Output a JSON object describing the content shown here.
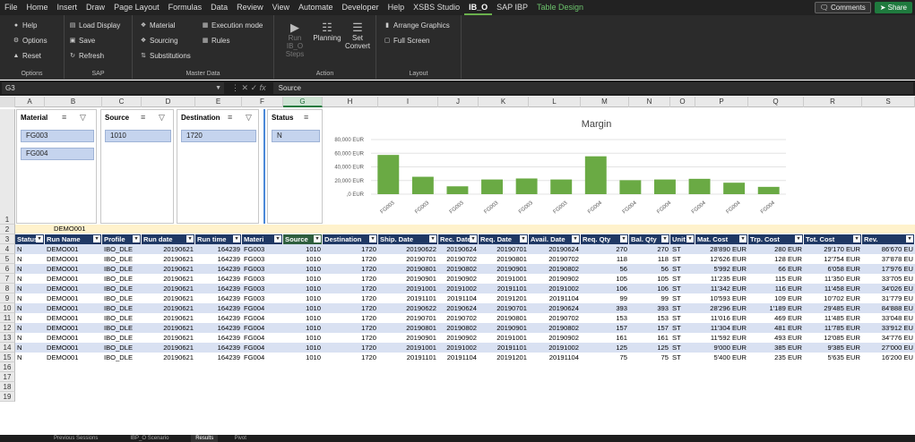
{
  "menu": {
    "tabs": [
      "File",
      "Home",
      "Insert",
      "Draw",
      "Page Layout",
      "Formulas",
      "Data",
      "Review",
      "View",
      "Automate",
      "Developer",
      "Help",
      "XSBS Studio",
      "IB_O",
      "SAP IBP",
      "Table Design"
    ],
    "active_tab": "IB_O",
    "comments_label": "Comments",
    "share_label": "Share"
  },
  "ribbon": {
    "options_group": {
      "label": "Options",
      "items": [
        "Help",
        "Options",
        "Reset"
      ]
    },
    "sap_group": {
      "label": "SAP",
      "items": [
        "Load Display",
        "Save",
        "Refresh"
      ]
    },
    "master_group": {
      "label": "Master Data",
      "items": [
        "Material",
        "Sourcing",
        "Substitutions",
        "Execution mode",
        "Rules"
      ]
    },
    "action_group": {
      "label": "Action",
      "run_label": "Run IB_O Steps",
      "planning_label": "Planning",
      "set_convert_label": "Set Convert"
    },
    "layout_group": {
      "label": "Layout",
      "items": [
        "Arrange Graphics",
        "Full Screen"
      ]
    }
  },
  "formula_bar": {
    "name_box": "G3",
    "formula": "Source"
  },
  "columns": [
    "A",
    "B",
    "C",
    "D",
    "E",
    "F",
    "G",
    "H",
    "I",
    "J",
    "K",
    "L",
    "M",
    "N",
    "O",
    "P",
    "Q",
    "R",
    "S"
  ],
  "selected_column": "G",
  "slicers": [
    {
      "title": "Material",
      "items": [
        "FG003",
        "FG004"
      ]
    },
    {
      "title": "Source",
      "items": [
        "1010"
      ]
    },
    {
      "title": "Destination",
      "items": [
        "1720"
      ]
    },
    {
      "title": "Status",
      "items": [
        "N"
      ]
    }
  ],
  "chart_data": {
    "type": "bar",
    "title": "Margin",
    "categories": [
      "FG003",
      "FG003",
      "FG003",
      "FG003",
      "FG003",
      "FG003",
      "FG004",
      "FG004",
      "FG004",
      "FG004",
      "FG004",
      "FG004"
    ],
    "values": [
      57500,
      25500,
      11500,
      21500,
      23000,
      21500,
      55500,
      20500,
      21500,
      22500,
      16800,
      10700
    ],
    "ylim": [
      0,
      80000
    ],
    "yticks": [
      "80,000 EUR",
      "60,000 EUR",
      "40,000 EUR",
      "20,000 EUR",
      ",0 EUR"
    ],
    "color": "#6aaa44"
  },
  "row2_label": "DEMO001",
  "table": {
    "headers": [
      "Status",
      "Run Name",
      "Profile",
      "Run date",
      "Run time",
      "Materi",
      "Source",
      "Destination",
      "Ship. Date",
      "Rec. Date",
      "Req. Date",
      "Avail. Date",
      "Req. Qty",
      "Bal. Qty",
      "Unit",
      "Mat. Cost",
      "Trp. Cost",
      "Tot. Cost",
      "Rev."
    ],
    "rows": [
      [
        "N",
        "DEMO001",
        "IBO_DLE",
        "20190621",
        "164239",
        "FG003",
        "1010",
        "1720",
        "20190622",
        "20190624",
        "20190701",
        "20190624",
        "270",
        "270",
        "ST",
        "28'890 EUR",
        "280 EUR",
        "29'170 EUR",
        "86'670 EU"
      ],
      [
        "N",
        "DEMO001",
        "IBO_DLE",
        "20190621",
        "164239",
        "FG003",
        "1010",
        "1720",
        "20190701",
        "20190702",
        "20190801",
        "20190702",
        "118",
        "118",
        "ST",
        "12'626 EUR",
        "128 EUR",
        "12'754 EUR",
        "37'878 EU"
      ],
      [
        "N",
        "DEMO001",
        "IBO_DLE",
        "20190621",
        "164239",
        "FG003",
        "1010",
        "1720",
        "20190801",
        "20190802",
        "20190901",
        "20190802",
        "56",
        "56",
        "ST",
        "5'992 EUR",
        "66 EUR",
        "6'058 EUR",
        "17'976 EU"
      ],
      [
        "N",
        "DEMO001",
        "IBO_DLE",
        "20190621",
        "164239",
        "FG003",
        "1010",
        "1720",
        "20190901",
        "20190902",
        "20191001",
        "20190902",
        "105",
        "105",
        "ST",
        "11'235 EUR",
        "115 EUR",
        "11'350 EUR",
        "33'705 EU"
      ],
      [
        "N",
        "DEMO001",
        "IBO_DLE",
        "20190621",
        "164239",
        "FG003",
        "1010",
        "1720",
        "20191001",
        "20191002",
        "20191101",
        "20191002",
        "106",
        "106",
        "ST",
        "11'342 EUR",
        "116 EUR",
        "11'458 EUR",
        "34'026 EU"
      ],
      [
        "N",
        "DEMO001",
        "IBO_DLE",
        "20190621",
        "164239",
        "FG003",
        "1010",
        "1720",
        "20191101",
        "20191104",
        "20191201",
        "20191104",
        "99",
        "99",
        "ST",
        "10'593 EUR",
        "109 EUR",
        "10'702 EUR",
        "31'779 EU"
      ],
      [
        "N",
        "DEMO001",
        "IBO_DLE",
        "20190621",
        "164239",
        "FG004",
        "1010",
        "1720",
        "20190622",
        "20190624",
        "20190701",
        "20190624",
        "393",
        "393",
        "ST",
        "28'296 EUR",
        "1'189 EUR",
        "29'485 EUR",
        "84'888 EU"
      ],
      [
        "N",
        "DEMO001",
        "IBO_DLE",
        "20190621",
        "164239",
        "FG004",
        "1010",
        "1720",
        "20190701",
        "20190702",
        "20190801",
        "20190702",
        "153",
        "153",
        "ST",
        "11'016 EUR",
        "469 EUR",
        "11'485 EUR",
        "33'048 EU"
      ],
      [
        "N",
        "DEMO001",
        "IBO_DLE",
        "20190621",
        "164239",
        "FG004",
        "1010",
        "1720",
        "20190801",
        "20190802",
        "20190901",
        "20190802",
        "157",
        "157",
        "ST",
        "11'304 EUR",
        "481 EUR",
        "11'785 EUR",
        "33'912 EU"
      ],
      [
        "N",
        "DEMO001",
        "IBO_DLE",
        "20190621",
        "164239",
        "FG004",
        "1010",
        "1720",
        "20190901",
        "20190902",
        "20191001",
        "20190902",
        "161",
        "161",
        "ST",
        "11'592 EUR",
        "493 EUR",
        "12'085 EUR",
        "34'776 EU"
      ],
      [
        "N",
        "DEMO001",
        "IBO_DLE",
        "20190621",
        "164239",
        "FG004",
        "1010",
        "1720",
        "20191001",
        "20191002",
        "20191101",
        "20191002",
        "125",
        "125",
        "ST",
        "9'000 EUR",
        "385 EUR",
        "9'385 EUR",
        "27'000 EU"
      ],
      [
        "N",
        "DEMO001",
        "IBO_DLE",
        "20190621",
        "164239",
        "FG004",
        "1010",
        "1720",
        "20191101",
        "20191104",
        "20191201",
        "20191104",
        "75",
        "75",
        "ST",
        "5'400 EUR",
        "235 EUR",
        "5'635 EUR",
        "16'200 EU"
      ]
    ]
  },
  "row_numbers": [
    "1",
    "2",
    "3",
    "4",
    "5",
    "6",
    "7",
    "8",
    "9",
    "10",
    "11",
    "12",
    "13",
    "14",
    "15",
    "16",
    "17",
    "18",
    "19"
  ],
  "sheet_tabs": [
    "Previous Sessions",
    "IBP_O Scenario",
    "Results",
    "Pivot"
  ],
  "active_sheet": "Results"
}
